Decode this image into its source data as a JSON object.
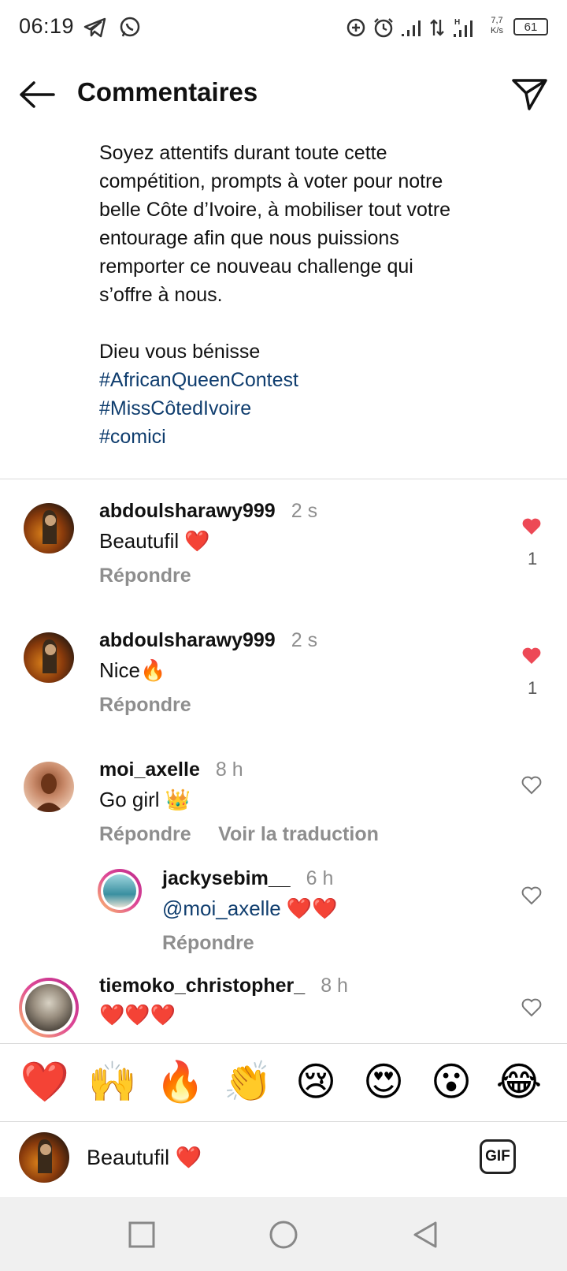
{
  "status_bar": {
    "time": "06:19",
    "net_speed_value": "7,7",
    "net_speed_unit": "K/s",
    "battery": "61"
  },
  "header": {
    "title": "Commentaires"
  },
  "caption": {
    "lines": [
      "Soyez attentifs durant toute cette",
      "compétition, prompts à voter pour notre",
      "belle Côte d’Ivoire, à mobiliser tout votre",
      "entourage  afin que nous puissions",
      "remporter ce nouveau challenge qui",
      "s’offre à nous.",
      "",
      "Dieu vous bénisse"
    ],
    "hashtags": [
      "#AfricanQueenContest",
      "#MissCôtedIvoire",
      "#comici"
    ]
  },
  "comments": [
    {
      "username": "abdoulsharawy999",
      "time": "2 s",
      "text": "Beautufil",
      "emoji": "❤️",
      "reply_label": "Répondre",
      "liked": true,
      "like_count": "1"
    },
    {
      "username": "abdoulsharawy999",
      "time": "2 s",
      "text": "Nice",
      "emoji": "🔥",
      "reply_label": "Répondre",
      "liked": true,
      "like_count": "1"
    },
    {
      "username": "moi_axelle",
      "time": "8 h",
      "text": "Go girl",
      "emoji": "👑",
      "reply_label": "Répondre",
      "translate_label": "Voir la traduction",
      "liked": false
    },
    {
      "username": "jackysebim__",
      "time": "6 h",
      "text": "@moi_axelle",
      "emoji": "❤️❤️",
      "reply_label": "Répondre",
      "liked": false
    },
    {
      "username": "tiemoko_christopher_",
      "time": "8 h",
      "text": "",
      "emoji": "❤️❤️❤️",
      "liked": false
    }
  ],
  "reactions": [
    "❤️",
    "🙌",
    "🔥",
    "👏",
    "😢",
    "😍",
    "😮",
    "😂"
  ],
  "compose": {
    "text": "Beautufil",
    "emoji": "❤️",
    "gif_label": "GIF"
  },
  "colors": {
    "like_red": "#ed4956",
    "hashtag": "#0f3d6e",
    "muted": "#8e8e8e"
  }
}
